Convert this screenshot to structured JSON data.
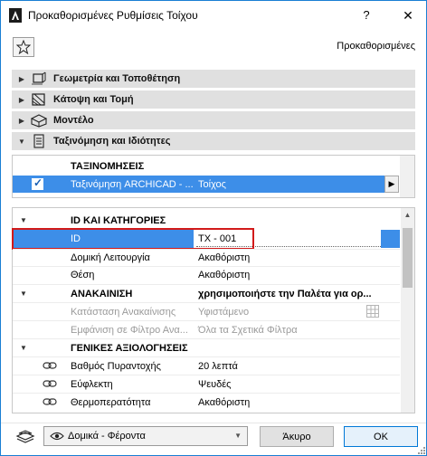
{
  "window": {
    "title": "Προκαθορισμένες Ρυθμίσεις Τοίχου",
    "help_label": "?",
    "close_label": "✕"
  },
  "header": {
    "defaults_label": "Προκαθορισμένες"
  },
  "sections": [
    {
      "label": "Γεωμετρία και Τοποθέτηση",
      "icon": "wall-geometry-icon",
      "expanded": false
    },
    {
      "label": "Κάτοψη και Τομή",
      "icon": "floor-plan-section-icon",
      "expanded": false
    },
    {
      "label": "Μοντέλο",
      "icon": "model-3d-icon",
      "expanded": false
    },
    {
      "label": "Ταξινόμηση και Ιδιότητες",
      "icon": "document-list-icon",
      "expanded": true
    }
  ],
  "classifications": {
    "header": "ΤΑΞΙΝΟΜΗΣΕΙΣ",
    "row": {
      "name": "Ταξινόμηση ARCHICAD - ...",
      "value": "Τοίχος",
      "checked": true
    }
  },
  "properties": {
    "groups": [
      {
        "header": "ID ΚΑΙ ΚΑΤΗΓΟΡΙΕΣ",
        "note": "",
        "rows": [
          {
            "name": "ID",
            "value": "ΤΧ - 001",
            "selected": true
          },
          {
            "name": "Δομική Λειτουργία",
            "value": "Ακαθόριστη"
          },
          {
            "name": "Θέση",
            "value": "Ακαθόριστη"
          }
        ]
      },
      {
        "header": "ΑΝΑΚΑΙΝΙΣΗ",
        "note": "χρησιμοποιήστε την Παλέτα για ορ...",
        "rows": [
          {
            "name": "Κατάσταση Ανακαίνισης",
            "value": "Υφιστάμενο",
            "disabled": true
          },
          {
            "name": "Εμφάνιση σε Φίλτρο Ανα...",
            "value": "Όλα τα Σχετικά Φίλτρα",
            "disabled": true
          }
        ]
      },
      {
        "header": "ΓΕΝΙΚΕΣ ΑΞΙΟΛΟΓΗΣΕΙΣ",
        "note": "",
        "rows": [
          {
            "name": "Βαθμός Πυραντοχής",
            "value": "20 λεπτά",
            "linked": true
          },
          {
            "name": "Εύφλεκτη",
            "value": "Ψευδές",
            "linked": true
          },
          {
            "name": "Θερμοπερατότητα",
            "value": "Ακαθόριστη",
            "linked": true
          }
        ]
      }
    ]
  },
  "footer": {
    "layer_value": "Δομικά - Φέροντα",
    "cancel_label": "Άκυρο",
    "ok_label": "OK"
  },
  "colors": {
    "selection": "#3d8ee8",
    "highlight_border": "#d21a1a",
    "section_bg": "#e0e0e0"
  }
}
